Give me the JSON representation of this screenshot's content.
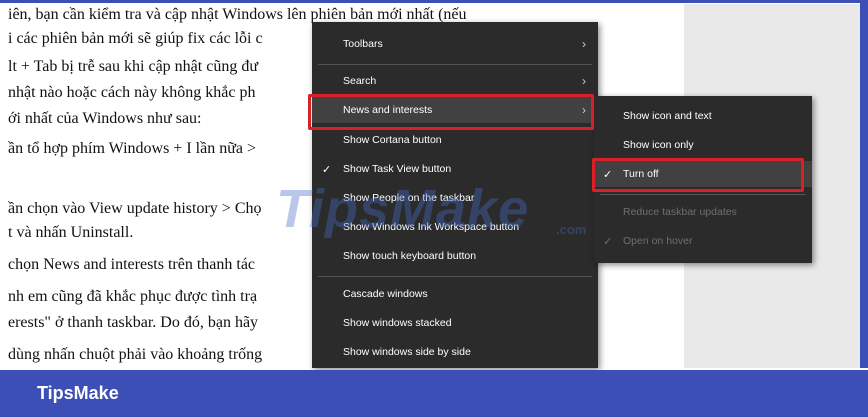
{
  "document": {
    "lines": [
      "iên, bạn cần kiểm tra và cập nhật Windows lên phiên bản mới nhất (nếu",
      "i các phiên bản mới sẽ giúp fix các lỗi c",
      "lt + Tab bị trễ sau khi cập nhật cũng đư",
      " nhật nào hoặc cách này không khắc ph",
      "ới nhất của Windows như sau:",
      "ần tổ hợp phím Windows + I lần nữa >",
      "ần chọn vào View update history > Chọ",
      "t và nhấn Uninstall.",
      "chọn News and interests trên thanh tác",
      "nh em cũng đã khắc phục được tình trạ",
      "erests\" ở thanh taskbar. Do đó, bạn hãy",
      "dùng nhấn chuột phải vào khoảng trống"
    ]
  },
  "context_menu": {
    "items": [
      {
        "label": "Toolbars",
        "has_submenu": true
      },
      {
        "label": "Search",
        "has_submenu": true
      },
      {
        "label": "News and interests",
        "has_submenu": true,
        "highlighted": true
      },
      {
        "label": "Show Cortana button"
      },
      {
        "label": "Show Task View button",
        "checked": true
      },
      {
        "label": "Show People on the taskbar"
      },
      {
        "label": "Show Windows Ink Workspace button"
      },
      {
        "label": "Show touch keyboard button"
      },
      {
        "label": "Cascade windows"
      },
      {
        "label": "Show windows stacked"
      },
      {
        "label": "Show windows side by side"
      }
    ],
    "arrow_glyph": "›",
    "check_glyph": "✓"
  },
  "submenu": {
    "items": [
      {
        "label": "Show icon and text"
      },
      {
        "label": "Show icon only"
      },
      {
        "label": "Turn off",
        "checked": true,
        "highlighted": true
      },
      {
        "label": "Reduce taskbar updates",
        "disabled": true
      },
      {
        "label": "Open on hover",
        "checked": true,
        "disabled": true
      }
    ]
  },
  "watermark": {
    "text": "TipsMake",
    "suffix": ".com"
  },
  "footer": {
    "brand": "TipsMake"
  },
  "colors": {
    "menu_bg": "#2b2b2b",
    "highlight_border": "#d82127",
    "brand_blue": "#3b4fb6"
  }
}
